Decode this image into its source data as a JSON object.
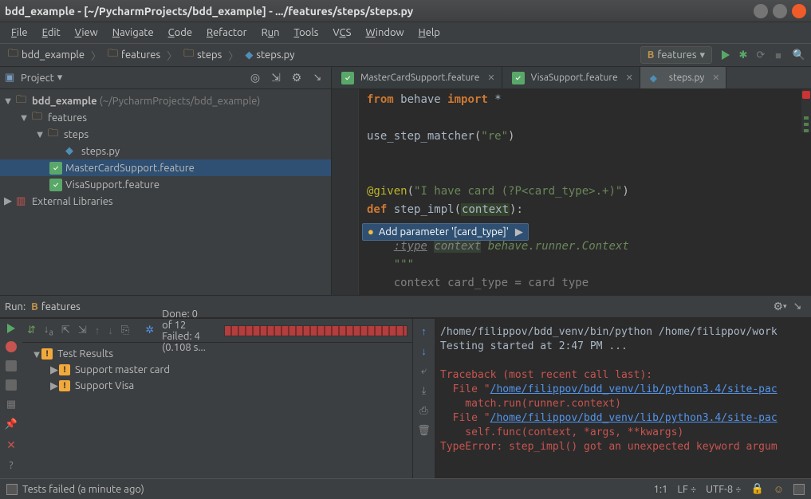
{
  "window": {
    "title": "bdd_example - [~/PycharmProjects/bdd_example] - .../features/steps/steps.py"
  },
  "menubar": [
    "File",
    "Edit",
    "View",
    "Navigate",
    "Code",
    "Refactor",
    "Run",
    "Tools",
    "VCS",
    "Window",
    "Help"
  ],
  "breadcrumbs": [
    {
      "icon": "folder",
      "label": "bdd_example"
    },
    {
      "icon": "folder",
      "label": "features"
    },
    {
      "icon": "folder",
      "label": "steps"
    },
    {
      "icon": "python",
      "label": "steps.py"
    }
  ],
  "run_config": {
    "icon": "B",
    "label": "features"
  },
  "project": {
    "header": "Project",
    "tree": {
      "root": {
        "name": "bdd_example",
        "hint": "(~/PycharmProjects/bdd_example)"
      },
      "features": "features",
      "steps": "steps",
      "steps_py": "steps.py",
      "mastercard": "MasterCardSupport.feature",
      "visa": "VisaSupport.feature",
      "external": "External Libraries"
    }
  },
  "tabs": [
    {
      "label": "MasterCardSupport.feature",
      "icon": "feature"
    },
    {
      "label": "VisaSupport.feature",
      "icon": "feature"
    },
    {
      "label": "steps.py",
      "icon": "python",
      "active": true
    }
  ],
  "code": {
    "from": "from",
    "module": "behave",
    "import": "import",
    "star": "*",
    "usm": "use_step_matcher",
    "re_str": "\"re\"",
    "given": "@given",
    "given_str": "\"I have card (?P<card_type>.+)\"",
    "def": "def",
    "fn": "step_impl",
    "param": "context",
    "doc1": ":type",
    "doc2": "context",
    "doc3": "behave.runner.Context",
    "docq": "\"\"\"",
    "last": "context card_type = card type"
  },
  "intention": "Add parameter '[card_type]'",
  "run_panel": {
    "title_prefix": "Run:",
    "title_name": "features",
    "status": "Done: 0 of 12  Failed: 4  (0.108 s...",
    "test_results": "Test Results",
    "test1": "Support master card",
    "test2": "Support Visa",
    "console": {
      "l1": "/home/filippov/bdd_venv/bin/python /home/filippov/work",
      "l2": "Testing started at 2:47 PM ...",
      "l3": "Traceback (most recent call last):",
      "l4p": "  File \"",
      "l4l": "/home/filippov/bdd_venv/lib/python3.4/site-pac",
      "l5": "    match.run(runner.context)",
      "l6p": "  File \"",
      "l6l": "/home/filippov/bdd_venv/lib/python3.4/site-pac",
      "l7": "    self.func(context, *args, **kwargs)",
      "l8": "TypeError: step_impl() got an unexpected keyword argum"
    }
  },
  "statusbar": {
    "left": "Tests failed (a minute ago)",
    "pos": "1:1",
    "lf": "LF",
    "enc": "UTF-8"
  }
}
